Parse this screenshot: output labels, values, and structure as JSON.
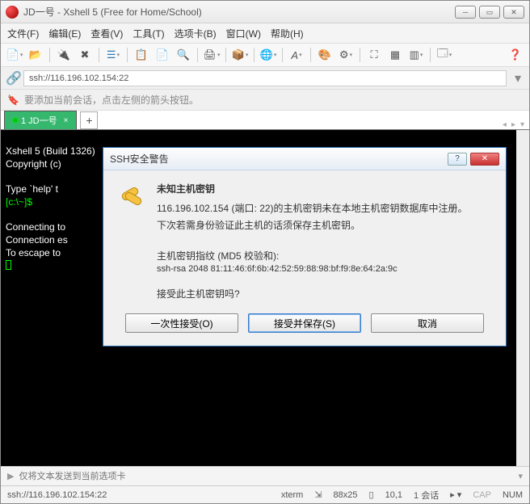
{
  "titlebar": {
    "title": "JD一号 - Xshell 5 (Free for Home/School)"
  },
  "menu": {
    "file": "文件(F)",
    "edit": "编辑(E)",
    "view": "查看(V)",
    "tools": "工具(T)",
    "tabs": "选项卡(B)",
    "window": "窗口(W)",
    "help": "帮助(H)"
  },
  "address": "ssh://116.196.102.154:22",
  "hint": "要添加当前会话，点击左侧的箭头按钮。",
  "tab": {
    "label": "1 JD一号"
  },
  "terminal": {
    "l1": "Xshell 5 (Build 1326)",
    "l2": "Copyright (c) ",
    "l3": "Type `help' t",
    "l4a": "[c:\\~]$",
    "l5": "Connecting to ",
    "l6": "Connection es",
    "l7": "To escape to "
  },
  "cmdbar": {
    "placeholder": "仅将文本发送到当前选项卡"
  },
  "status": {
    "conn": "ssh://116.196.102.154:22",
    "term": "xterm",
    "size": "88x25",
    "pos": "10,1",
    "sess": "1 会话",
    "cap": "CAP",
    "num": "NUM"
  },
  "dialog": {
    "title": "SSH安全警告",
    "heading": "未知主机密钥",
    "line1": "116.196.102.154 (端口: 22)的主机密钥未在本地主机密钥数据库中注册。",
    "line2": "下次若需身份验证此主机的话须保存主机密钥。",
    "fp_label": "主机密钥指纹 (MD5 校验和):",
    "fp_value": "ssh-rsa 2048 81:11:46:6f:6b:42:52:59:88:98:bf:f9:8e:64:2a:9c",
    "question": "接受此主机密钥吗?",
    "btn_once": "一次性接受(O)",
    "btn_save": "接受并保存(S)",
    "btn_cancel": "取消"
  }
}
